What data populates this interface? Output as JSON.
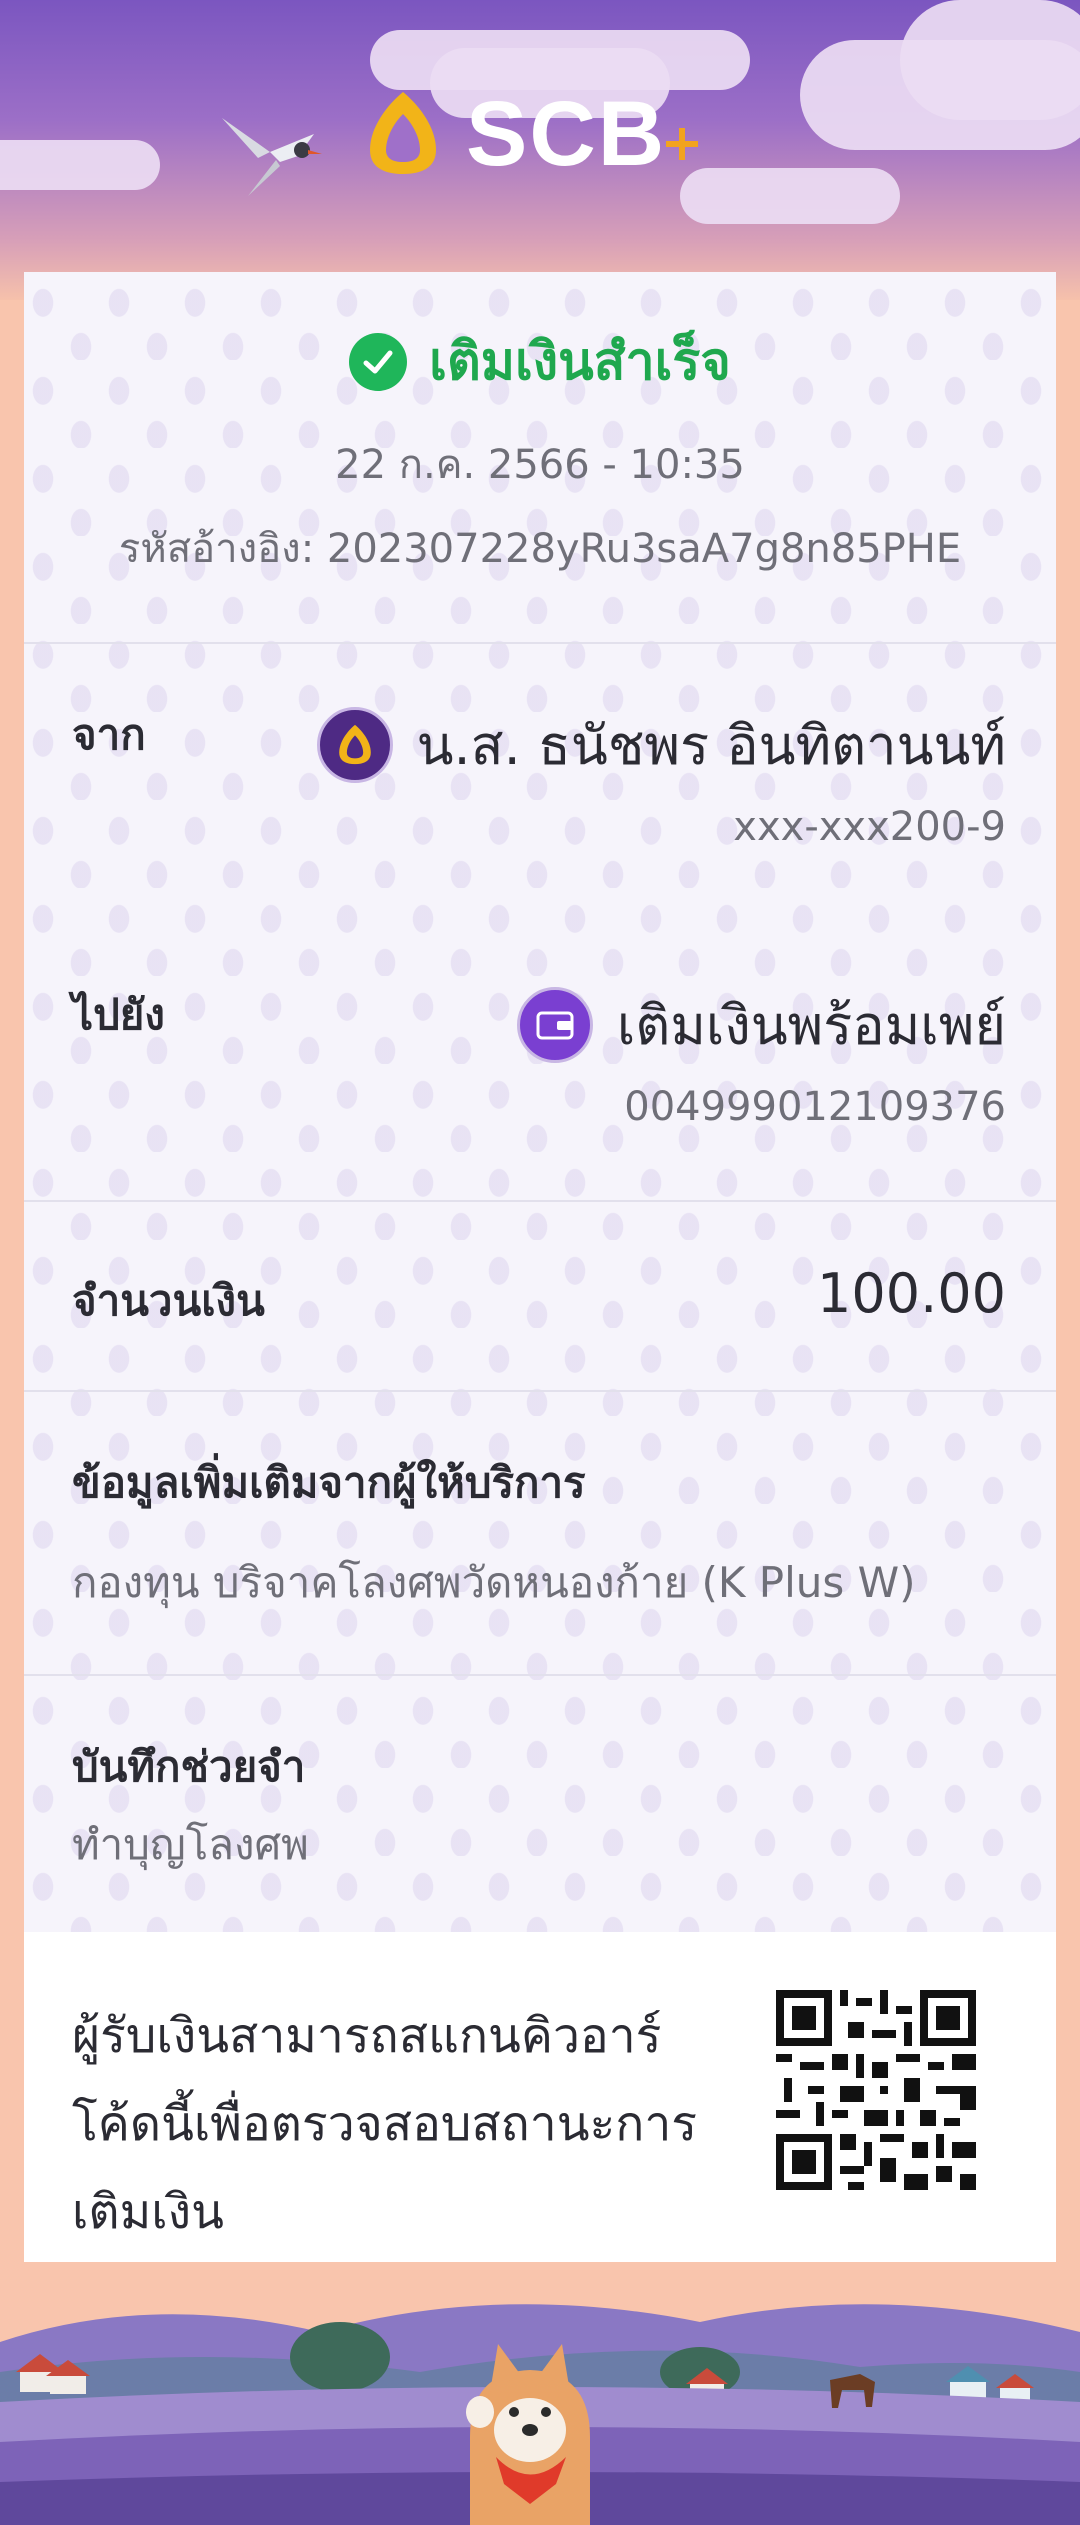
{
  "header": {
    "brand": "SCB",
    "colors": {
      "sky_top": "#7b56c0",
      "brand_gold": "#f2b418",
      "success": "#1fb65a"
    }
  },
  "status": {
    "icon": "check-circle-icon",
    "text": "เติมเงินสำเร็จ",
    "datetime": "22 ก.ค. 2566 - 10:35",
    "reference": "รหัสอ้างอิง: 202307228yRu3saA7g8n85PHE"
  },
  "from": {
    "label": "จาก",
    "name": "น.ส. ธนัชพร อินทิตานนท์",
    "account": "xxx-xxx200-9",
    "icon": "scb-bell-icon"
  },
  "to": {
    "label": "ไปยัง",
    "name": "เติมเงินพร้อมเพย์",
    "account": "004999012109376",
    "icon": "wallet-icon"
  },
  "amount": {
    "label": "จำนวนเงิน",
    "value": "100.00"
  },
  "provider_info": {
    "label": "ข้อมูลเพิ่มเติมจากผู้ให้บริการ",
    "value": "กองทุน บริจาคโลงศพวัดหนองก้าย (K Plus W)"
  },
  "memo": {
    "label": "บันทึกช่วยจำ",
    "value": "ทำบุญโลงศพ"
  },
  "qr": {
    "line1": "ผู้รับเงินสามารถสแกนคิวอาร์",
    "line2": "โค้ดนี้เพื่อตรวจสอบสถานะการ",
    "line3": "เติมเงิน",
    "icon": "qr-code-icon"
  }
}
